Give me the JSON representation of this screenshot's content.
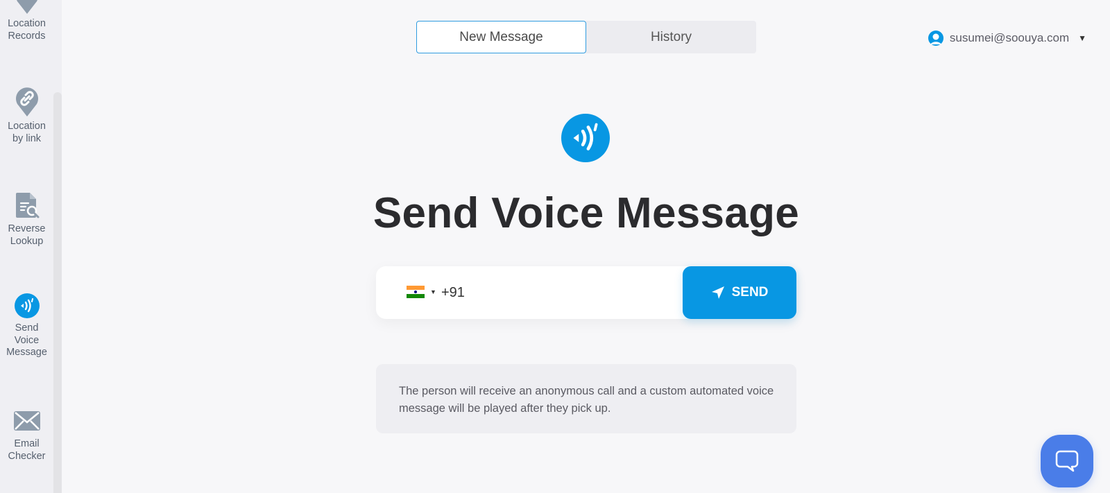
{
  "sidebar": {
    "items": [
      {
        "label": "Location Records",
        "icon": "location-pin-icon"
      },
      {
        "label": "Location by link",
        "icon": "link-pin-icon"
      },
      {
        "label": "Reverse Lookup",
        "icon": "document-search-icon"
      },
      {
        "label": "Send Voice Message",
        "icon": "voice-message-icon",
        "active": true
      },
      {
        "label": "Email Checker",
        "icon": "envelope-icon"
      }
    ]
  },
  "tabs": [
    {
      "label": "New Message",
      "active": true
    },
    {
      "label": "History",
      "active": false
    }
  ],
  "user": {
    "email": "susumei@soouya.com",
    "icon": "user-avatar-icon"
  },
  "main": {
    "title": "Send Voice Message",
    "phone": {
      "country": "India",
      "dial_code": "+91",
      "value": "",
      "placeholder": ""
    },
    "send_label": "SEND",
    "info_text": "The person will receive an anonymous call and a custom automated voice message will be played after they pick up."
  },
  "colors": {
    "accent": "#0897e3",
    "chat": "#4a7de8",
    "sidebar_icon": "#8e9cab"
  }
}
